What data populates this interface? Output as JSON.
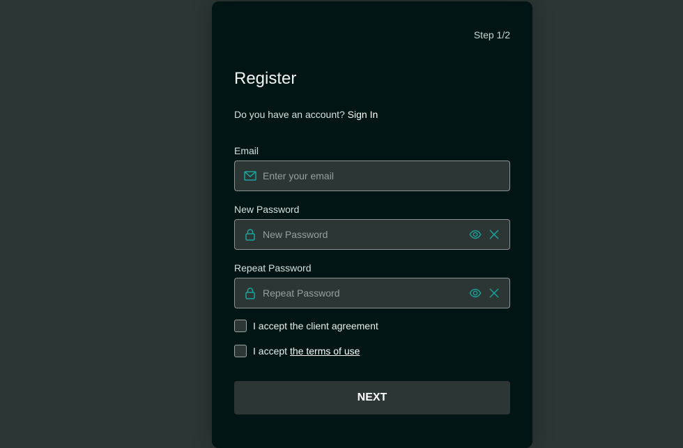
{
  "header": {
    "step": "Step 1/2",
    "title": "Register"
  },
  "account": {
    "prompt": "Do you have an account?",
    "link": "Sign In"
  },
  "email": {
    "label": "Email",
    "placeholder": "Enter your email",
    "value": "",
    "icon": "mail-icon"
  },
  "new_password": {
    "label": "New Password",
    "placeholder": "New Password",
    "value": "",
    "icon": "lock-icon"
  },
  "repeat_password": {
    "label": "Repeat Password",
    "placeholder": "Repeat Password",
    "value": "",
    "icon": "lock-icon"
  },
  "agreements": {
    "client": {
      "text": "I accept the client agreement",
      "checked": false
    },
    "terms": {
      "prefix": "I accept",
      "link": "the terms of use",
      "checked": false
    }
  },
  "next_button": "NEXT",
  "colors": {
    "accent": "#1aa39b",
    "card": "#001514",
    "background": "#2c3634"
  }
}
